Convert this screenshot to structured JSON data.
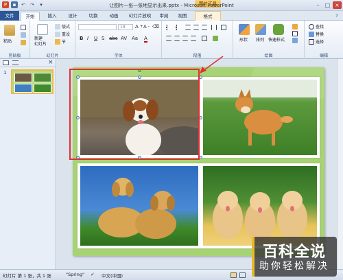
{
  "window": {
    "title": "让图片一张一张地显示出来.pptx - Microsoft PowerPoint",
    "contextual_tab": "图片工具"
  },
  "tabs": [
    "文件",
    "开始",
    "插入",
    "设计",
    "切换",
    "动画",
    "幻灯片放映",
    "审阅",
    "视图",
    "格式"
  ],
  "ribbon": {
    "clipboard": {
      "paste": "粘贴",
      "label": "剪贴板"
    },
    "slides": {
      "new_slide": "新建\n幻灯片",
      "layout": "版式",
      "reset": "重设",
      "section": "节",
      "label": "幻灯片"
    },
    "font": {
      "size": "18",
      "label": "字体"
    },
    "paragraph": {
      "label": "段落"
    },
    "drawing": {
      "shapes": "形状",
      "arrange": "排列",
      "quick_styles": "快速样式",
      "label": "绘图"
    },
    "editing": {
      "find": "查找",
      "replace": "替换",
      "select": "选择",
      "label": "编辑"
    }
  },
  "panel": {
    "slide_number": "1"
  },
  "status": {
    "slide_info": "幻灯片 第 1 张，共 1 张",
    "theme": "\"Spring\"",
    "language": "中文(中国)"
  },
  "watermark": {
    "line1": "百科全说",
    "line2": "助你轻松解决"
  },
  "colors": {
    "file_tab": "#2b5798",
    "slide_bg": "#a8d374",
    "selection_red": "#e03131",
    "contextual": "#eab54e"
  }
}
